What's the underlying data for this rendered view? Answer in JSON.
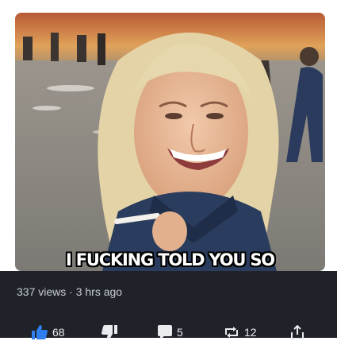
{
  "meme": {
    "caption": "I FUCKING TOLD YOU SO"
  },
  "post": {
    "views_text": "337 views · 3 hrs ago"
  },
  "actions": {
    "likes": "68",
    "comments": "5",
    "reposts": "12",
    "accent_color": "#2f7ef0"
  }
}
